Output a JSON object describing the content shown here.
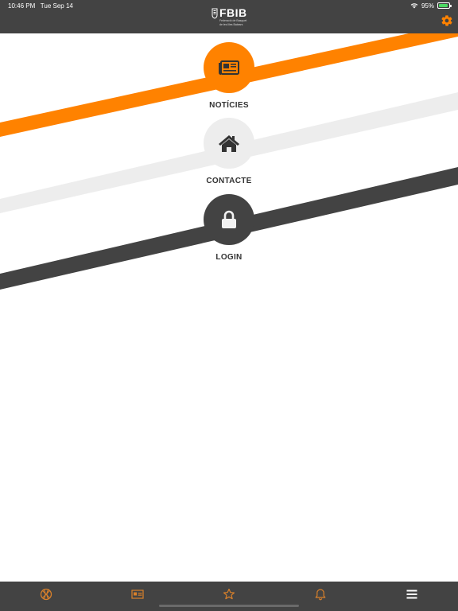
{
  "status_bar": {
    "time": "10:46 PM",
    "date": "Tue Sep 14",
    "battery_percent": "95%"
  },
  "header": {
    "logo_text": "FBIB",
    "logo_subtitle_line1": "Federació de Basquet",
    "logo_subtitle_line2": "de les Illes Balears",
    "settings_icon": "gear-icon"
  },
  "colors": {
    "header_bg": "#434343",
    "accent_orange": "#ff8200",
    "stripe_light": "#ededed",
    "stripe_dark": "#434343",
    "tab_icon": "#d9802a"
  },
  "menu": {
    "items": [
      {
        "label": "NOTÍCIES",
        "icon": "newspaper-icon",
        "circle_color": "#ff8200"
      },
      {
        "label": "CONTACTE",
        "icon": "home-icon",
        "circle_color": "#ededed"
      },
      {
        "label": "LOGIN",
        "icon": "lock-icon",
        "circle_color": "#434343"
      }
    ]
  },
  "tabbar": {
    "tabs": [
      {
        "name": "basketball",
        "icon": "basketball-icon"
      },
      {
        "name": "profile-card",
        "icon": "id-card-icon"
      },
      {
        "name": "favorites",
        "icon": "star-icon"
      },
      {
        "name": "notifications",
        "icon": "bell-icon"
      },
      {
        "name": "menu",
        "icon": "hamburger-menu-icon"
      }
    ]
  }
}
